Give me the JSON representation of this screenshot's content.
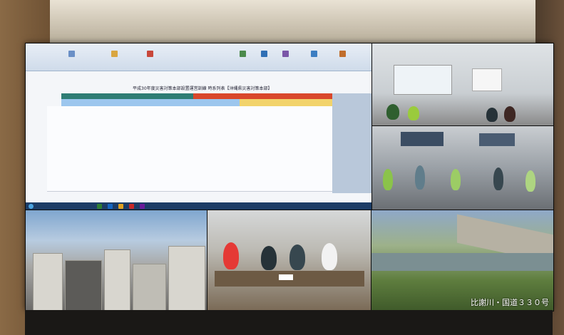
{
  "spreadsheet": {
    "title": "平成30年度災害対策本部設置運営訓練 時系列表【沖縄県災害対策本部】"
  },
  "camera_river": {
    "caption": "比謝川・国道３３０号"
  }
}
